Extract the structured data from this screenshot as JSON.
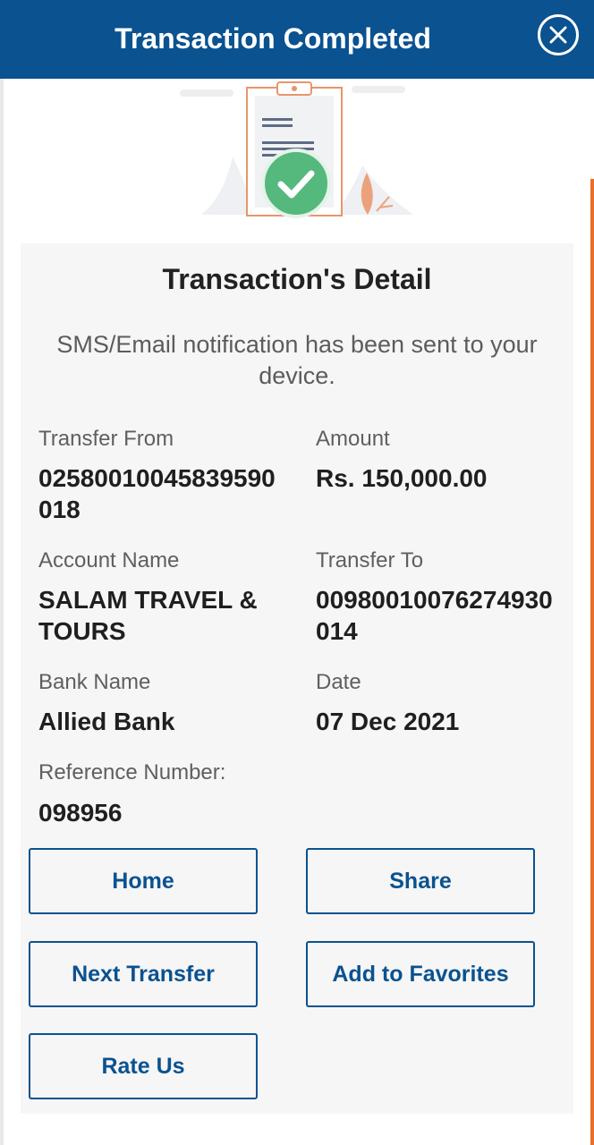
{
  "header": {
    "title": "Transaction Completed",
    "close_icon": "close-circle-icon"
  },
  "illustration": {
    "icon": "clipboard-check-icon",
    "check_color": "#55b87d",
    "accent_color": "#e99466"
  },
  "detail": {
    "title": "Transaction's Detail",
    "notice": "SMS/Email notification has been sent to your device.",
    "fields": {
      "transfer_from": {
        "label": "Transfer From",
        "value": "02580010045839590018"
      },
      "amount": {
        "label": "Amount",
        "value": "Rs. 150,000.00"
      },
      "account_name": {
        "label": "Account Name",
        "value": "SALAM TRAVEL & TOURS"
      },
      "transfer_to": {
        "label": "Transfer To",
        "value": "00980010076274930014"
      },
      "bank_name": {
        "label": "Bank Name",
        "value": "Allied Bank"
      },
      "date": {
        "label": "Date",
        "value": "07 Dec 2021"
      },
      "reference_number": {
        "label": "Reference Number:",
        "value": "098956"
      }
    }
  },
  "buttons": {
    "home": "Home",
    "share": "Share",
    "next_transfer": "Next Transfer",
    "add_to_favorites": "Add to Favorites",
    "rate_us": "Rate Us"
  },
  "colors": {
    "primary": "#0a5290",
    "success": "#55b87d",
    "accent": "#e96f2a",
    "card_background": "#f6f6f6"
  }
}
